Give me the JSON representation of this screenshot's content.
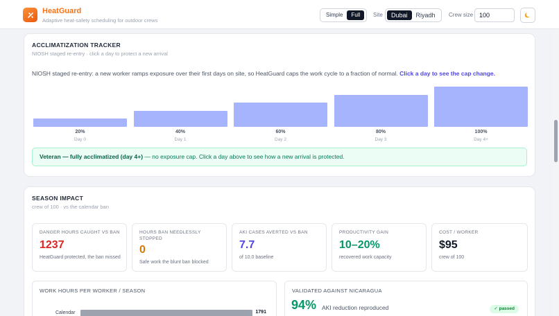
{
  "app": {
    "name": "HeatGuard",
    "tagline": "Adaptive heat-safety scheduling for outdoor crews"
  },
  "header": {
    "modes": [
      "Simple",
      "Full"
    ],
    "active_mode": "Full",
    "site_label": "Site",
    "sites": [
      "Dubai",
      "Riyadh"
    ],
    "active_site": "Dubai",
    "crew_label": "Crew size",
    "crew_value": "100",
    "theme_icon": "moon-icon"
  },
  "acclimatization": {
    "title": "ACCLIMATIZATION TRACKER",
    "subtitle": "NIOSH staged re-entry · click a day to protect a new arrival",
    "intro": "NIOSH staged re-entry: a new worker ramps exposure over their first days on site, so HeatGuard caps the work cycle to a fraction of normal.",
    "intro_cta": "Click a day to see the cap change.",
    "days": [
      {
        "label": "Day 0",
        "pct_label": "20%",
        "value": 20
      },
      {
        "label": "Day 1",
        "pct_label": "40%",
        "value": 40
      },
      {
        "label": "Day 2",
        "pct_label": "60%",
        "value": 60
      },
      {
        "label": "Day 3",
        "pct_label": "80%",
        "value": 80
      },
      {
        "label": "Day 4+",
        "pct_label": "100%",
        "value": 100
      }
    ],
    "status_bold": "Veteran — fully acclimatized (day 4+)",
    "status_rest": " — no exposure cap. Click a day above to see how a new arrival is protected."
  },
  "season": {
    "title": "SEASON IMPACT",
    "subtitle": "crew of 100 · vs the calendar ban",
    "metrics": [
      {
        "label": "DANGER HOURS CAUGHT VS BAN",
        "value": "1237",
        "desc": "HeatGuard protected, the ban missed",
        "color": "#dc2626"
      },
      {
        "label": "HOURS BAN NEEDLESSLY STOPPED",
        "value": "0",
        "desc": "Safe work the blunt ban blocked",
        "color": "#d97706"
      },
      {
        "label": "AKI CASES AVERTED VS BAN",
        "value": "7.7",
        "desc": "of 10.0 baseline",
        "color": "#4f46e5"
      },
      {
        "label": "PRODUCTIVITY GAIN",
        "value": "10–20%",
        "desc": "recovered work capacity",
        "color": "#059669"
      },
      {
        "label": "COST / WORKER",
        "value": "$95",
        "desc": "crew of 100",
        "color": "#111827"
      }
    ],
    "work_hours": {
      "title": "WORK HOURS PER WORKER / SEASON",
      "rows": [
        {
          "label": "Calendar",
          "value": 1791,
          "value_label": "1791",
          "fill": 0.92
        }
      ]
    },
    "validation": {
      "title": "VALIDATED AGAINST NICARAGUA",
      "value": "94%",
      "text": "AKI reduction reproduced",
      "badge": "✓ passed"
    }
  }
}
